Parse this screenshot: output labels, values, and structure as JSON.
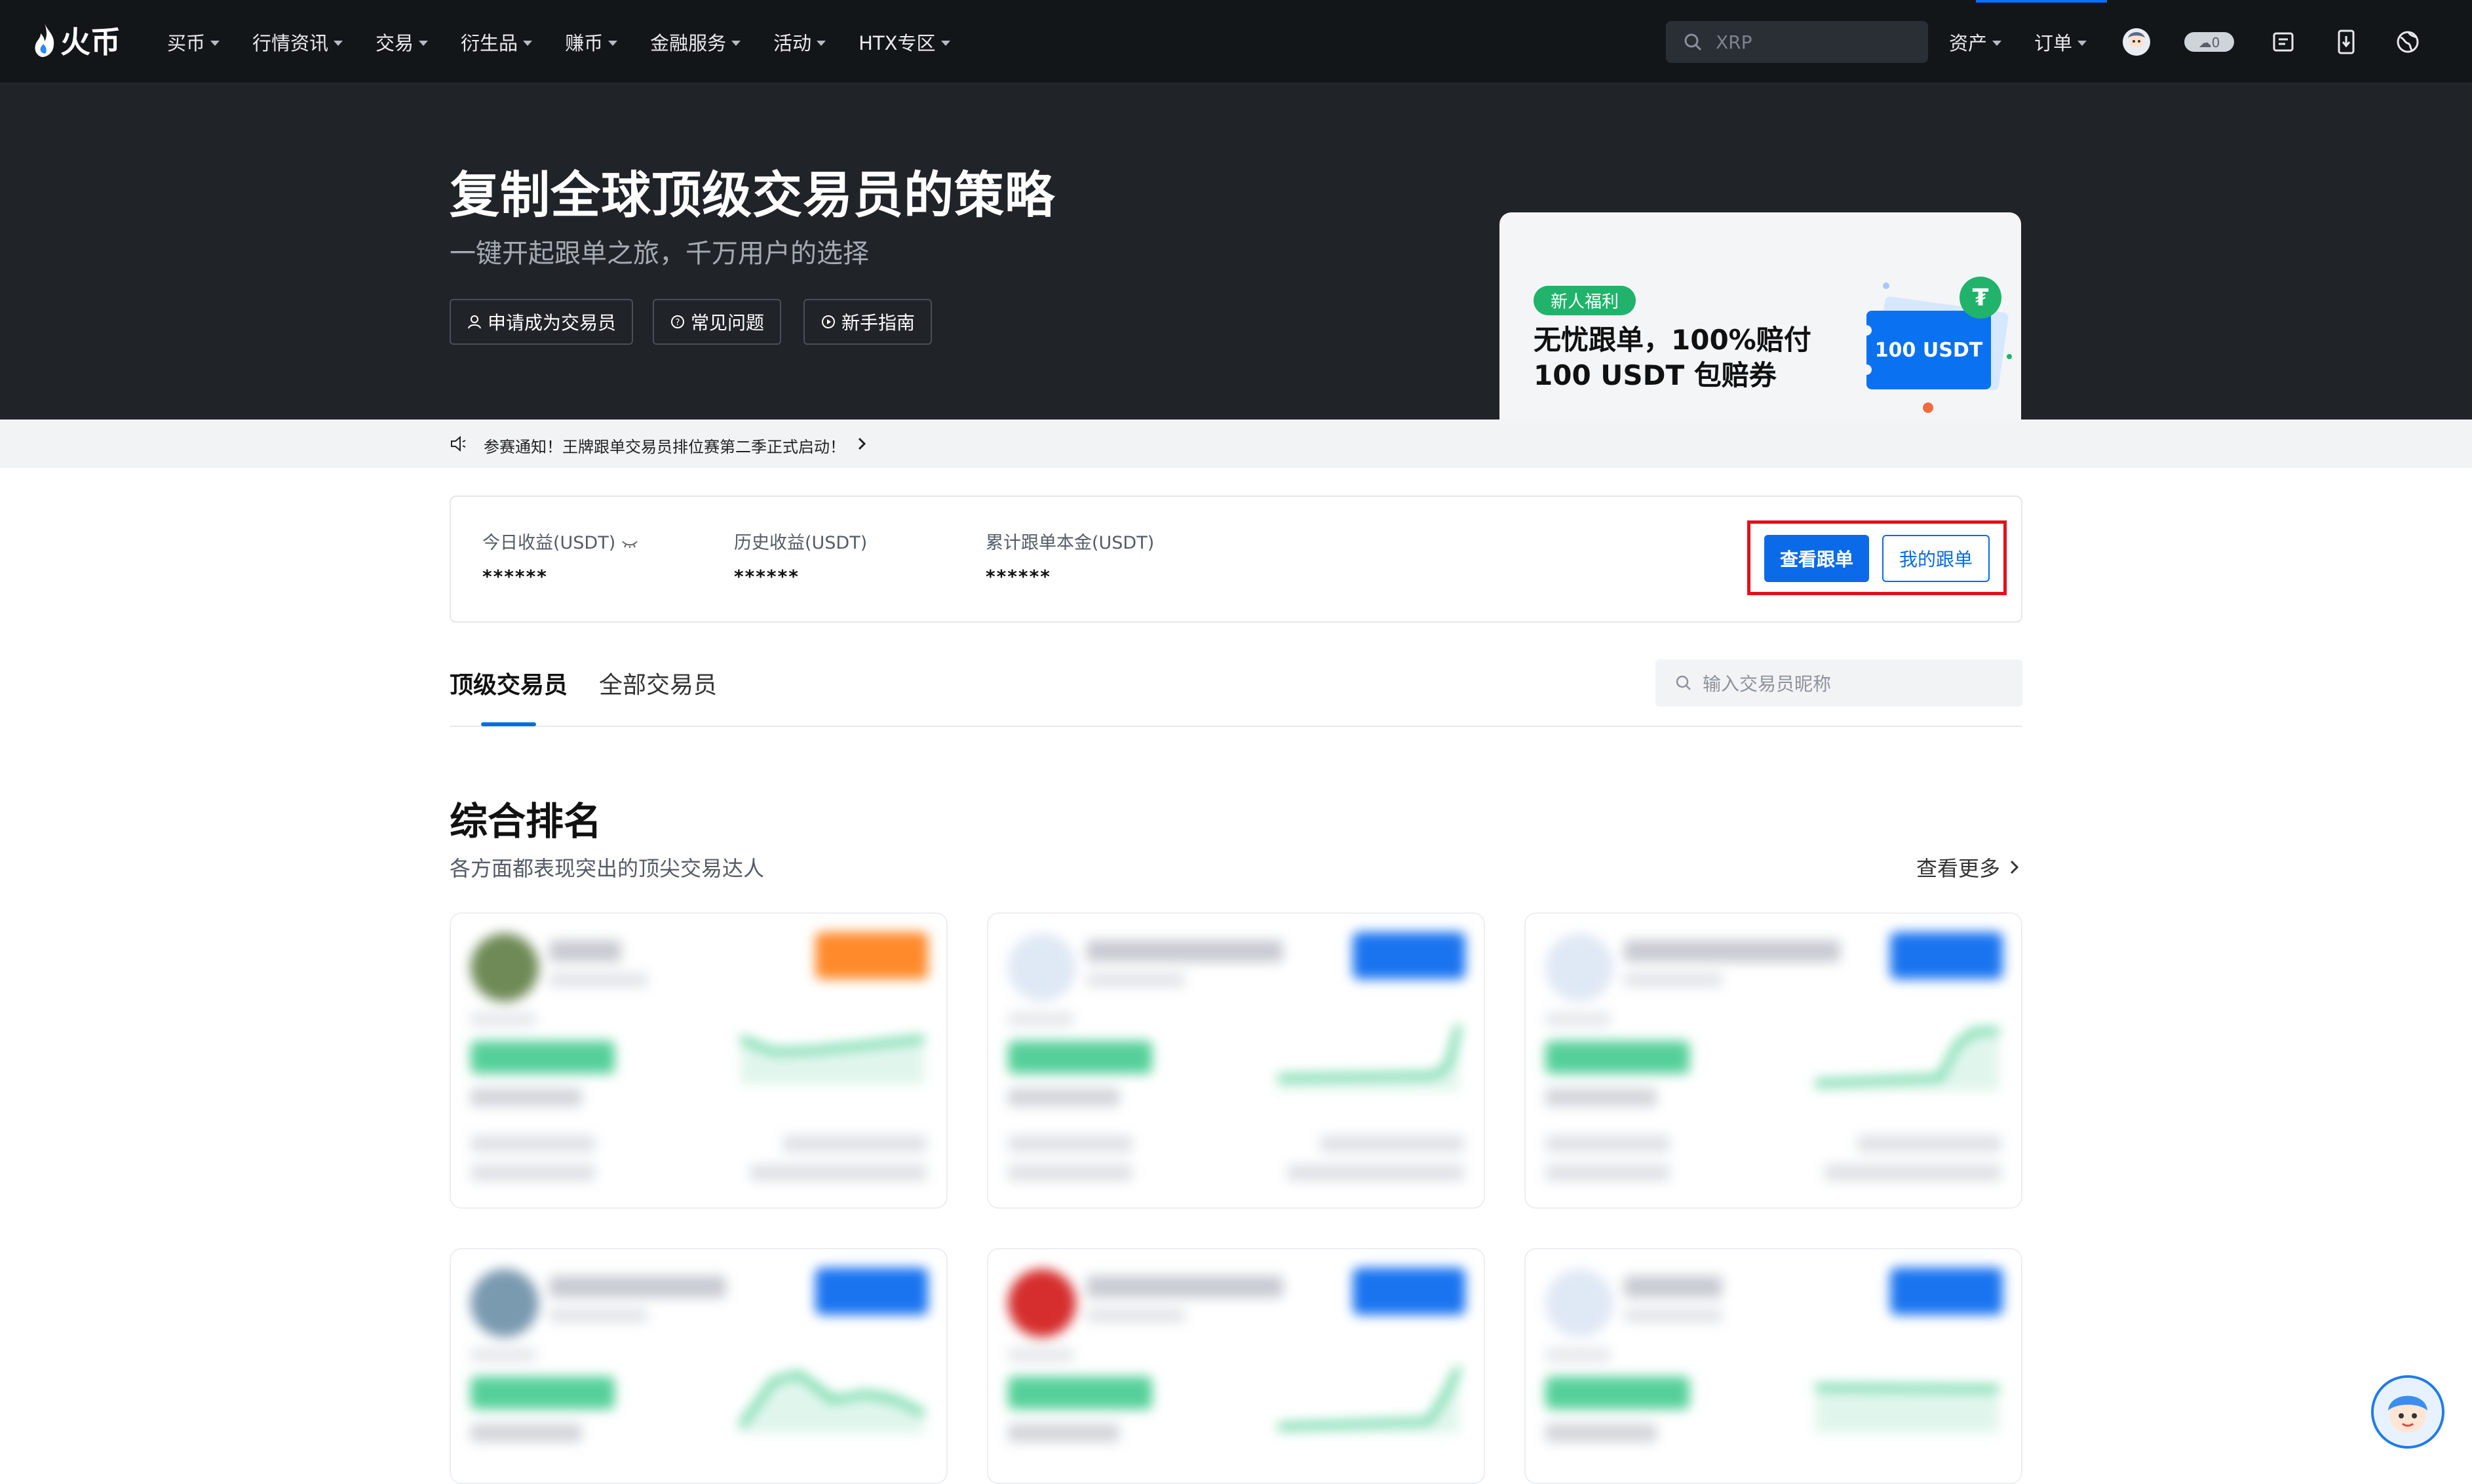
{
  "nav": {
    "logo_text": "火币",
    "menu": [
      {
        "label": "买币"
      },
      {
        "label": "行情资讯"
      },
      {
        "label": "交易"
      },
      {
        "label": "衍生品"
      },
      {
        "label": "赚币"
      },
      {
        "label": "金融服务"
      },
      {
        "label": "活动"
      },
      {
        "label": "HTX专区"
      }
    ],
    "search_value": "XRP",
    "assets_label": "资产",
    "orders_label": "订单",
    "accent": "#0073ff"
  },
  "hero": {
    "title": "复制全球顶级交易员的策略",
    "subtitle": "一键开起跟单之旅，千万用户的选择",
    "buttons": [
      {
        "label": "申请成为交易员",
        "icon": "user-icon"
      },
      {
        "label": "常见问题",
        "icon": "question-icon"
      },
      {
        "label": "新手指南",
        "icon": "play-icon"
      }
    ]
  },
  "banner": {
    "tag": "新人福利",
    "line1": "无忧跟单，100%赔付",
    "line2": "100 USDT 包赔券",
    "coupon_text": "100 USDT",
    "coin_symbol": "₮"
  },
  "notice": {
    "text": "参赛通知！王牌跟单交易员排位赛第二季正式启动！"
  },
  "stats": {
    "items": [
      {
        "label": "今日收益(USDT)",
        "value": "******"
      },
      {
        "label": "历史收益(USDT)",
        "value": "******"
      },
      {
        "label": "累计跟单本金(USDT)",
        "value": "******"
      }
    ],
    "view_copy_label": "查看跟单",
    "my_copy_label": "我的跟单",
    "highlight_color": "#e3101a"
  },
  "tabs": {
    "items": [
      {
        "label": "顶级交易员",
        "active": true
      },
      {
        "label": "全部交易员",
        "active": false
      }
    ],
    "search_placeholder": "输入交易员昵称"
  },
  "ranking": {
    "title": "综合排名",
    "subtitle": "各方面都表现突出的顶尖交易达人",
    "more_label": "查看更多"
  }
}
